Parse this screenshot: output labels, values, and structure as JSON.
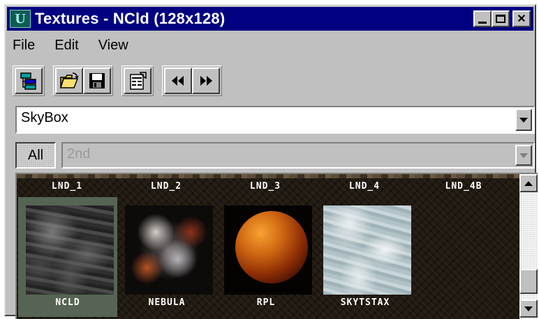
{
  "window": {
    "title": "Textures - NCld (128x128)"
  },
  "menu": {
    "file": "File",
    "edit": "Edit",
    "view": "View"
  },
  "toolbar": {
    "icons": [
      "tree-view-icon",
      "open-folder-icon",
      "save-icon",
      "properties-icon",
      "previous-icon",
      "next-icon"
    ]
  },
  "texture_set": {
    "selected": "SkyBox"
  },
  "filter": {
    "all_label": "All",
    "second_select": "2nd"
  },
  "texture_grid": {
    "row_labels": [
      "LND_1",
      "LND_2",
      "LND_3",
      "LND_4",
      "LND_4B"
    ],
    "textures": [
      {
        "name": "NCLD",
        "selected": true
      },
      {
        "name": "NEBULA",
        "selected": false
      },
      {
        "name": "RPL",
        "selected": false
      },
      {
        "name": "SKYTSTAX",
        "selected": false
      }
    ]
  },
  "colors": {
    "titlebar": "#000080",
    "chrome": "#c0c0c0",
    "selected_tile": "#566553"
  }
}
